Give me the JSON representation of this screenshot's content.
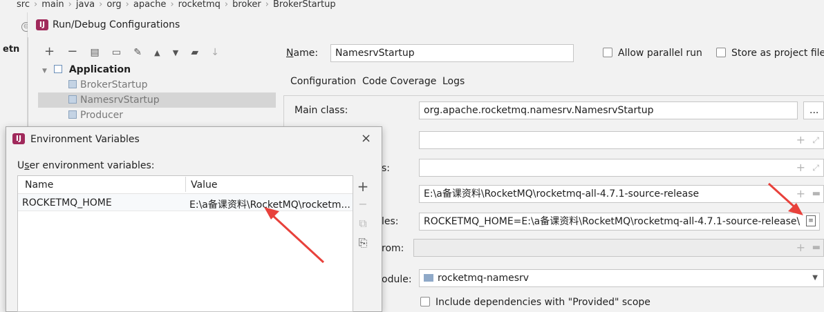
{
  "breadcrumb": [
    "src",
    "main",
    "java",
    "org",
    "apache",
    "rocketmq",
    "broker",
    "BrokerStartup"
  ],
  "ide_left_fragment": "etn",
  "dialog": {
    "title": "Run/Debug Configurations",
    "toolbar_icons": [
      "plus-icon",
      "minus-icon",
      "copy-icon",
      "save-icon",
      "wrench-icon",
      "arrow-up-icon",
      "arrow-down-icon",
      "move-into-folder-icon",
      "sort-icon"
    ],
    "tree": {
      "group": "Application",
      "items": [
        "BrokerStartup",
        "NamesrvStartup",
        "Producer"
      ],
      "selected": "NamesrvStartup"
    },
    "name_label": "Name:",
    "name_value": "NamesrvStartup",
    "allow_parallel_label": "Allow parallel run",
    "store_project_label": "Store as project file",
    "tabs": [
      "Configuration",
      "Code Coverage",
      "Logs"
    ],
    "main_class_label": "Main class:",
    "main_class_value": "org.apache.rocketmq.namesrv.NamesrvStartup",
    "browse_label": "...",
    "vm_options_partial": "",
    "program_args_partial": "s:",
    "working_dir_value": "E:\\a备课资料\\RocketMQ\\rocketmq-all-4.7.1-source-release",
    "env_vars_label_partial": "les:",
    "env_vars_value": "ROCKETMQ_HOME=E:\\a备课资料\\RocketMQ\\rocketmq-all-4.7.1-source-release\\",
    "redirect_label_partial": "rom:",
    "module_label_partial": "odule:",
    "module_value": "rocketmq-namesrv",
    "include_deps_label": "Include dependencies with \"Provided\" scope"
  },
  "env_dialog": {
    "title": "Environment Variables",
    "close": "×",
    "section_label": "User environment variables:",
    "columns": [
      "Name",
      "Value"
    ],
    "rows": [
      {
        "name": "ROCKETMQ_HOME",
        "value": "E:\\a备课资料\\RocketMQ\\rocketm..."
      }
    ],
    "side_buttons": [
      "+",
      "−",
      "⧉",
      "⎘"
    ]
  },
  "colors": {
    "annotation_arrow": "#e8413b",
    "dialog_bg": "#f2f2f2",
    "selection": "#d5d5d5"
  }
}
